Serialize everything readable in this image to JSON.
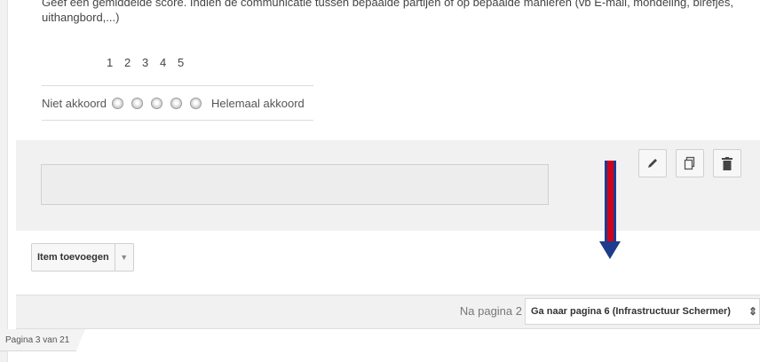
{
  "question": {
    "description": "Geef een gemiddelde score. Indien de communicatie tussen bepaalde partijen of op bepaalde manieren (vb E-mail, mondeling, birefjes, uithangbord,...)"
  },
  "scale": {
    "numbers": [
      "1",
      "2",
      "3",
      "4",
      "5"
    ],
    "min_label": "Niet akkoord",
    "max_label": "Helemaal akkoord"
  },
  "toolbar": {
    "edit_icon": "pencil-icon",
    "duplicate_icon": "copy-icon",
    "delete_icon": "trash-icon"
  },
  "add_item": {
    "label": "Item toevoegen"
  },
  "navigation": {
    "after_label": "Na pagina 2",
    "goto_value": "Ga naar pagina 6 (Infrastructuur Schermer)"
  },
  "page_indicator": "Pagina 3 van 21",
  "colors": {
    "arrow_fill": "#d0021b",
    "arrow_outline": "#1f3b8c"
  }
}
